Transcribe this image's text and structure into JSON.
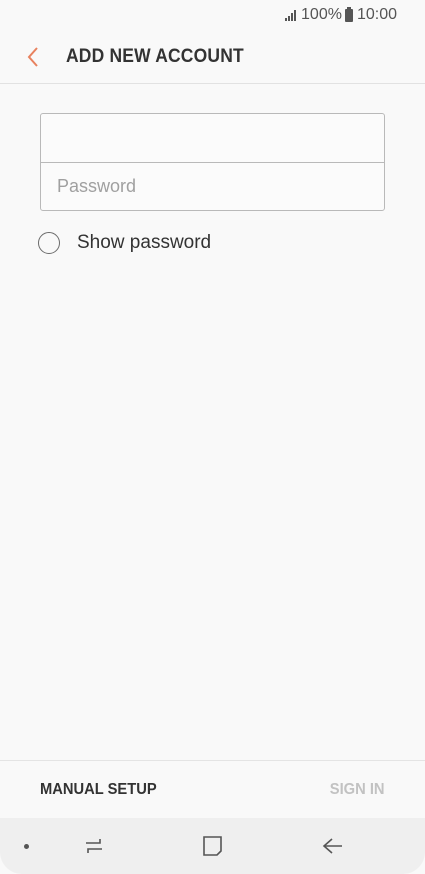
{
  "status_bar": {
    "battery": "100%",
    "time": "10:00",
    "icons": [
      "signal-icon",
      "battery-icon"
    ]
  },
  "header": {
    "title": "ADD NEW ACCOUNT",
    "back_icon": "chevron-left-icon"
  },
  "form": {
    "email_value": "",
    "email_placeholder": "",
    "password_value": "",
    "password_placeholder": "Password",
    "show_password_label": "Show password",
    "show_password_checked": false
  },
  "actions": {
    "manual_setup_label": "MANUAL SETUP",
    "sign_in_label": "SIGN IN"
  },
  "navigation": {
    "icons": [
      "dot-icon",
      "recent-apps-icon",
      "home-icon",
      "back-arrow-icon"
    ]
  },
  "colors": {
    "accent": "#e8825f",
    "background": "#f9f9f9",
    "text_primary": "#333333",
    "text_disabled": "#c2c2c2",
    "border": "#b9b9b9"
  }
}
